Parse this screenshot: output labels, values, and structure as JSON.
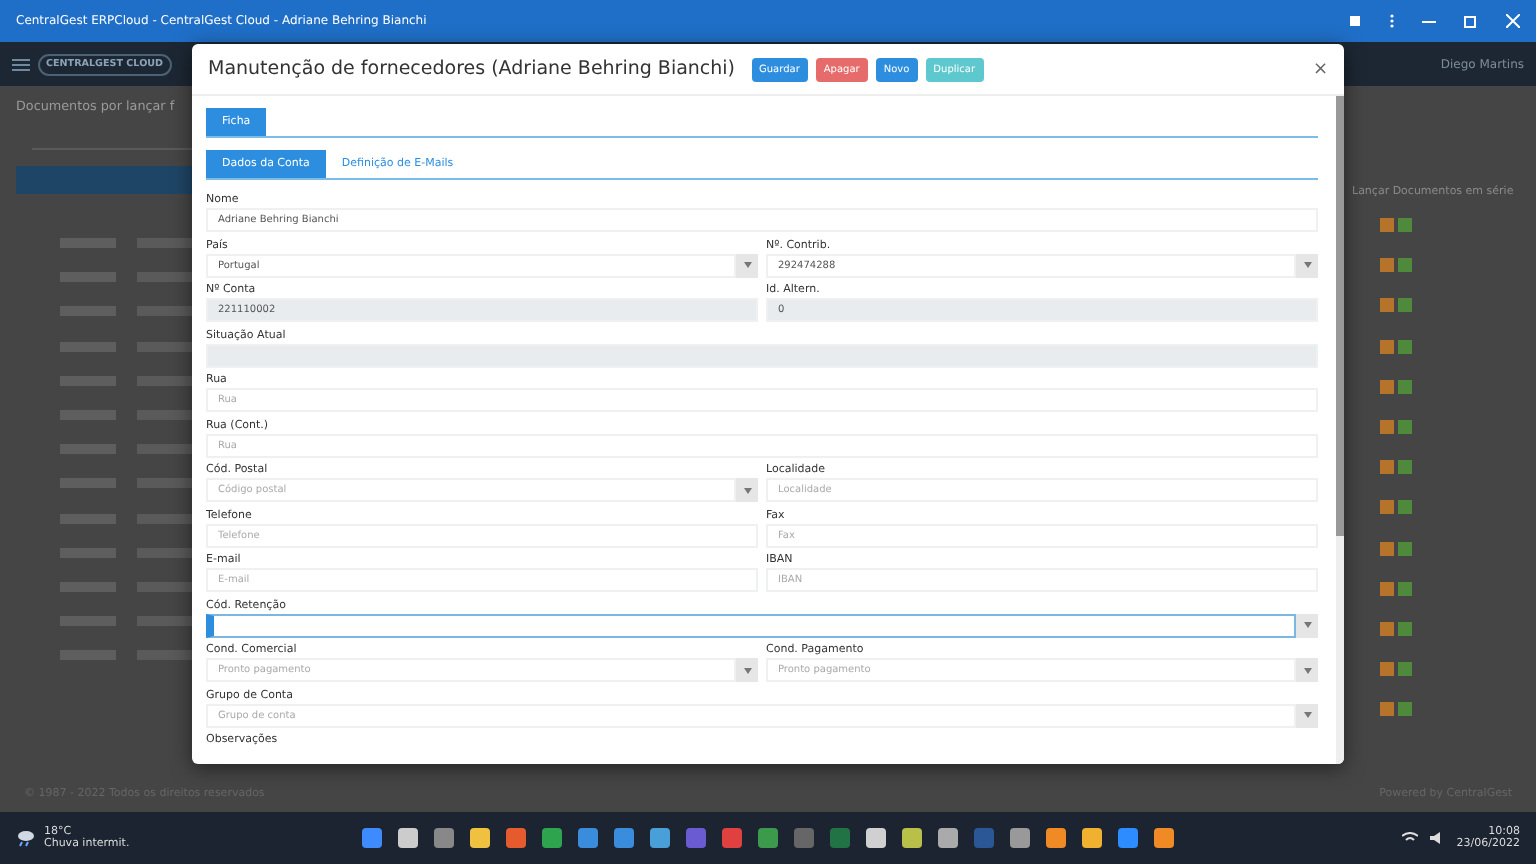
{
  "window": {
    "title": "CentralGest ERPCloud - CentralGest Cloud - Adriane Behring Bianchi"
  },
  "app_header": {
    "brand": "CENTRALGEST CLOUD",
    "user": "Diego Martins"
  },
  "page": {
    "heading": "Documentos por lançar f",
    "side_link": "Lançar Documentos em série"
  },
  "modal": {
    "title": "Manutenção de fornecedores (Adriane Behring Bianchi)",
    "close": "×",
    "actions": [
      {
        "label": "Guardar",
        "kind": "save"
      },
      {
        "label": "Apagar",
        "kind": "delete"
      },
      {
        "label": "Novo",
        "kind": "new"
      },
      {
        "label": "Duplicar",
        "kind": "duplicate"
      }
    ],
    "tabs": [
      {
        "label": "Ficha",
        "selected": true
      }
    ],
    "subtabs": [
      {
        "label": "Dados da Conta",
        "selected": true
      },
      {
        "label": "Definição de E-Mails",
        "selected": false
      }
    ],
    "rows": [
      [
        {
          "label": "Nome",
          "value": "Adriane Behring Bianchi",
          "kind": "text",
          "disabled": false
        }
      ],
      [
        {
          "label": "País",
          "value": "Portugal",
          "kind": "select",
          "disabled": false
        },
        {
          "label": "Nº. Contrib.",
          "value": "292474288",
          "kind": "select",
          "disabled": false
        }
      ],
      [
        {
          "label": "Nº Conta",
          "value": "221110002",
          "kind": "text",
          "disabled": true
        },
        {
          "label": "Id. Altern.",
          "value": "0",
          "kind": "text",
          "disabled": true
        }
      ],
      [
        {
          "label": "Situação Atual",
          "kind": "text",
          "disabled": true
        }
      ],
      [
        {
          "label": "Rua",
          "placeholder": "Rua",
          "kind": "text",
          "disabled": false
        }
      ],
      [
        {
          "label": "Rua (Cont.)",
          "placeholder": "Rua",
          "kind": "text",
          "disabled": false
        }
      ],
      [
        {
          "label": "Cód. Postal",
          "placeholder": "Código postal",
          "kind": "select",
          "disabled": false
        },
        {
          "label": "Localidade",
          "placeholder": "Localidade",
          "kind": "text",
          "disabled": false
        }
      ],
      [
        {
          "label": "Telefone",
          "placeholder": "Telefone",
          "kind": "text",
          "disabled": false
        },
        {
          "label": "Fax",
          "placeholder": "Fax",
          "kind": "text",
          "disabled": false
        }
      ],
      [
        {
          "label": "E-mail",
          "placeholder": "E-mail",
          "kind": "text",
          "disabled": false
        },
        {
          "label": "IBAN",
          "placeholder": "IBAN",
          "kind": "text",
          "disabled": false
        }
      ],
      [
        {
          "label": "Cód. Retenção",
          "kind": "select",
          "disabled": false,
          "focused": true
        }
      ],
      [
        {
          "label": "Cond. Comercial",
          "placeholder": "Pronto pagamento",
          "kind": "select",
          "disabled": false
        },
        {
          "label": "Cond. Pagamento",
          "placeholder": "Pronto pagamento",
          "kind": "select",
          "disabled": false
        }
      ],
      [
        {
          "label": "Grupo de Conta",
          "placeholder": "Grupo de conta",
          "kind": "select",
          "disabled": false
        }
      ],
      [
        {
          "label": "Observações",
          "kind": "label"
        }
      ]
    ]
  },
  "footer": {
    "copyright": "© 1987 - 2022 Todos os direitos reservados",
    "powered": "Powered by CentralGest"
  },
  "taskbar": {
    "temperature": "18°C",
    "weather": "Chuva intermit.",
    "time": "10:08",
    "date": "23/06/2022"
  }
}
